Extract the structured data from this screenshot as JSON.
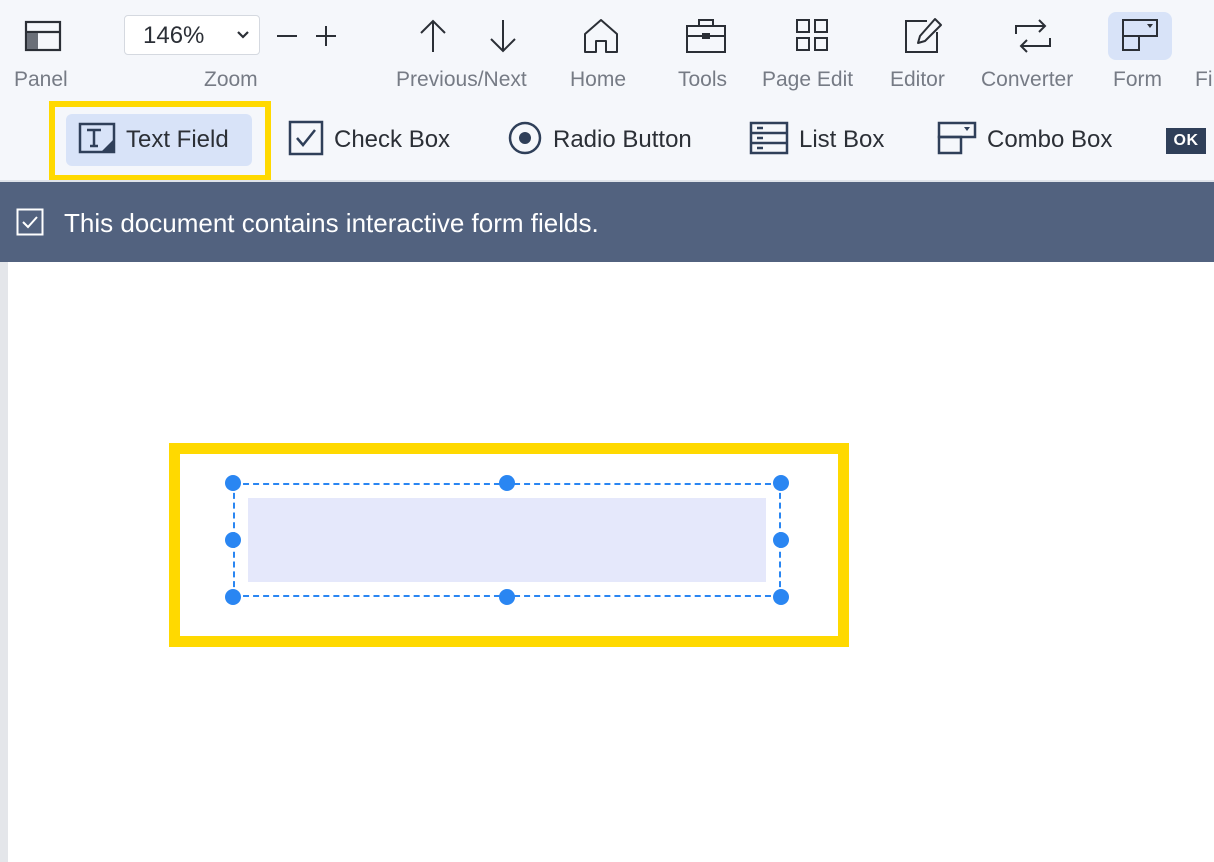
{
  "toolbar": {
    "panel_label": "Panel",
    "zoom_label": "Zoom",
    "zoom_value": "146%",
    "zoom_out_symbol": "−",
    "zoom_in_symbol": "+",
    "prevnext_label": "Previous/Next",
    "home_label": "Home",
    "tools_label": "Tools",
    "page_edit_label": "Page Edit",
    "editor_label": "Editor",
    "converter_label": "Converter",
    "form_label": "Form",
    "fill_label_partial": "Fi",
    "active_tab": "Form"
  },
  "form_tools": {
    "text_field": "Text Field",
    "check_box": "Check Box",
    "radio_button": "Radio Button",
    "list_box": "List Box",
    "combo_box": "Combo Box",
    "ok_button": "OK",
    "selected": "Text Field"
  },
  "banner": {
    "message": "This document contains interactive form fields."
  },
  "colors": {
    "highlight": "#ffd900",
    "banner_bg": "#52627f",
    "selection_blue": "#2a86f2",
    "active_tab_bg": "#d8e3f8",
    "field_fill": "#e5e8fb"
  },
  "icons": [
    "panel-icon",
    "chevron-down-icon",
    "minus-icon",
    "plus-icon",
    "arrow-up-icon",
    "arrow-down-icon",
    "home-icon",
    "toolbox-icon",
    "grid-icon",
    "edit-icon",
    "convert-icon",
    "form-icon",
    "text-field-icon",
    "checkbox-icon",
    "radio-icon",
    "list-box-icon",
    "combo-box-icon"
  ]
}
